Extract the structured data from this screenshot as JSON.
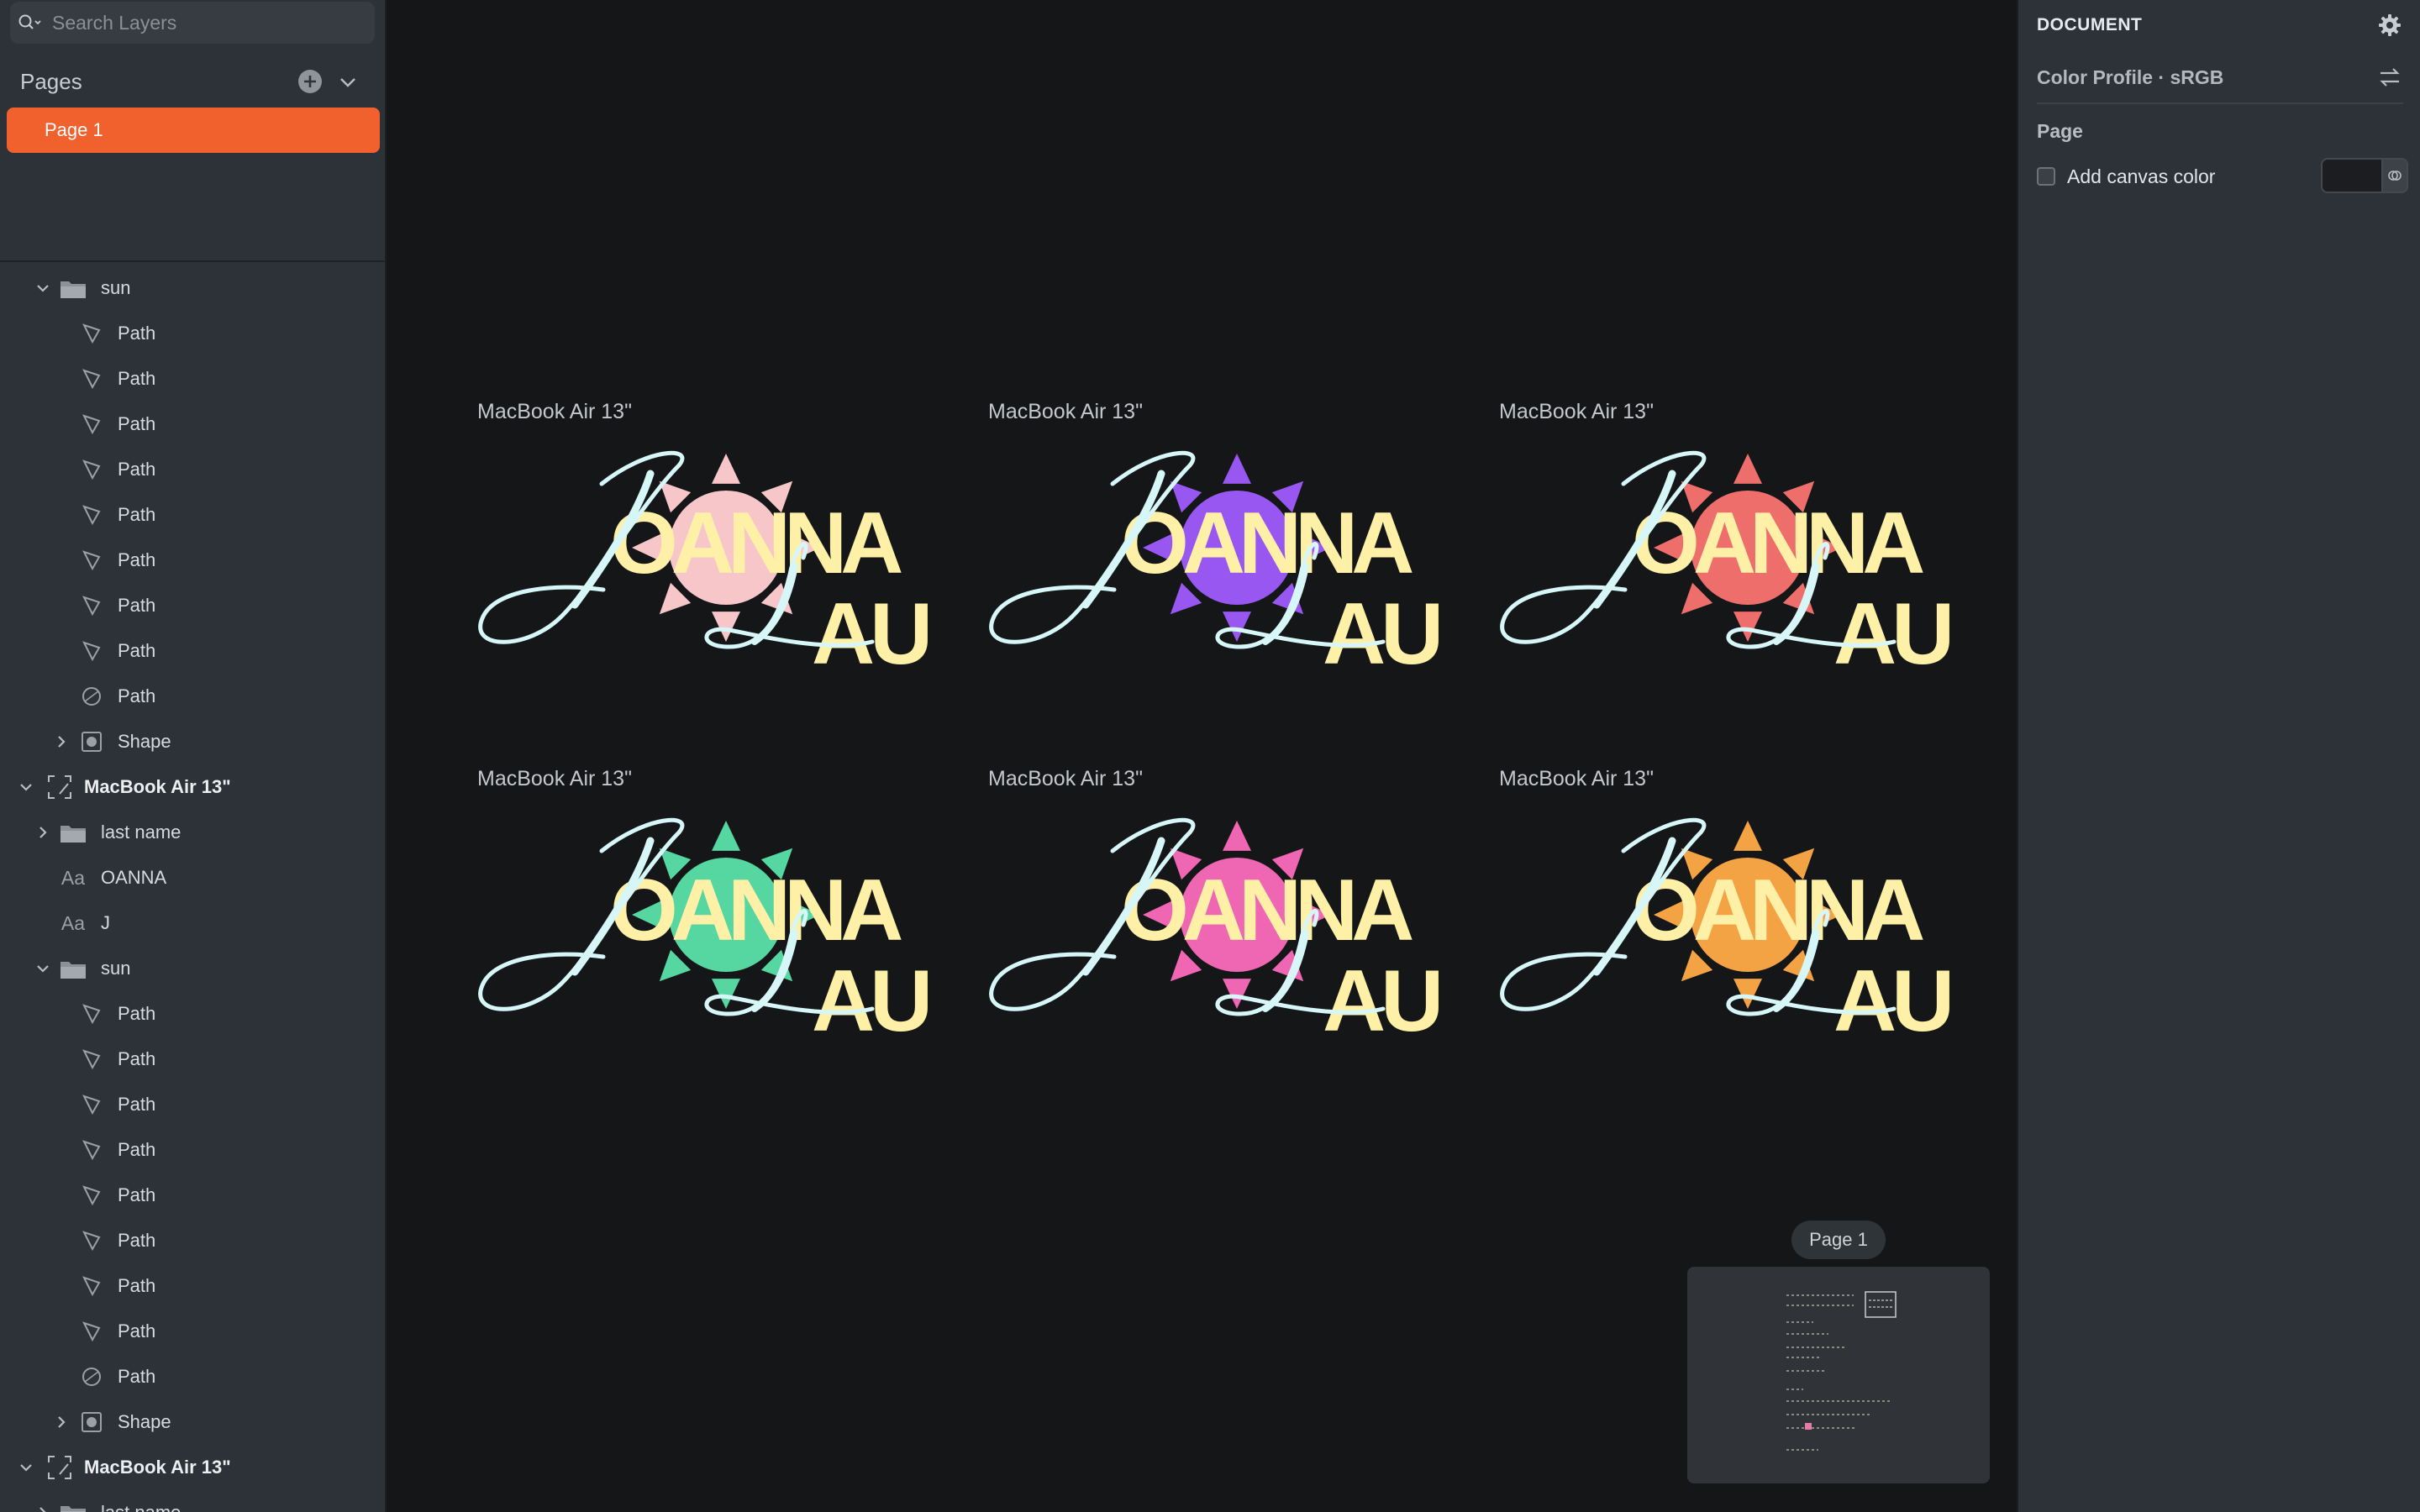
{
  "search": {
    "placeholder": "Search Layers"
  },
  "pages": {
    "title": "Pages",
    "items": [
      {
        "label": "Page 1",
        "selected": true
      }
    ]
  },
  "layers": [
    {
      "type": "group",
      "label": "sun",
      "depth": 2,
      "expanded": true
    },
    {
      "type": "path",
      "label": "Path",
      "depth": 3
    },
    {
      "type": "path",
      "label": "Path",
      "depth": 3
    },
    {
      "type": "path",
      "label": "Path",
      "depth": 3
    },
    {
      "type": "path",
      "label": "Path",
      "depth": 3
    },
    {
      "type": "path",
      "label": "Path",
      "depth": 3
    },
    {
      "type": "path",
      "label": "Path",
      "depth": 3
    },
    {
      "type": "path",
      "label": "Path",
      "depth": 3
    },
    {
      "type": "path",
      "label": "Path",
      "depth": 3
    },
    {
      "type": "oval",
      "label": "Path",
      "depth": 3
    },
    {
      "type": "shape",
      "label": "Shape",
      "depth": 3,
      "expanded": false
    },
    {
      "type": "artboard",
      "label": "MacBook Air 13\"",
      "depth": 1,
      "expanded": true
    },
    {
      "type": "group",
      "label": "last name",
      "depth": 2,
      "expanded": false
    },
    {
      "type": "text",
      "label": "OANNA",
      "depth": 2
    },
    {
      "type": "text",
      "label": "J",
      "depth": 2
    },
    {
      "type": "group",
      "label": "sun",
      "depth": 2,
      "expanded": true
    },
    {
      "type": "path",
      "label": "Path",
      "depth": 3
    },
    {
      "type": "path",
      "label": "Path",
      "depth": 3
    },
    {
      "type": "path",
      "label": "Path",
      "depth": 3
    },
    {
      "type": "path",
      "label": "Path",
      "depth": 3
    },
    {
      "type": "path",
      "label": "Path",
      "depth": 3
    },
    {
      "type": "path",
      "label": "Path",
      "depth": 3
    },
    {
      "type": "path",
      "label": "Path",
      "depth": 3
    },
    {
      "type": "path",
      "label": "Path",
      "depth": 3
    },
    {
      "type": "oval",
      "label": "Path",
      "depth": 3
    },
    {
      "type": "shape",
      "label": "Shape",
      "depth": 3,
      "expanded": false
    },
    {
      "type": "artboard",
      "label": "MacBook Air 13\"",
      "depth": 1,
      "expanded": true
    },
    {
      "type": "group",
      "label": "last name",
      "depth": 2,
      "expanded": false
    }
  ],
  "artboards": [
    {
      "title": "MacBook Air 13\"",
      "sun_color": "#f7c6c9"
    },
    {
      "title": "MacBook Air 13\"",
      "sun_color": "#9857f0"
    },
    {
      "title": "MacBook Air 13\"",
      "sun_color": "#ee6e6c"
    },
    {
      "title": "MacBook Air 13\"",
      "sun_color": "#56d6a0"
    },
    {
      "title": "MacBook Air 13\"",
      "sun_color": "#ef66b2"
    },
    {
      "title": "MacBook Air 13\"",
      "sun_color": "#f3a344"
    }
  ],
  "logo": {
    "script_letter": "J",
    "first_name": "OANNA",
    "script_letter_2": "L",
    "last_name": "AU",
    "script_color": "#d6f6f8",
    "block_color": "#fff0a8"
  },
  "page_pill": "Page 1",
  "inspector": {
    "title": "DOCUMENT",
    "color_profile": "Color Profile · sRGB",
    "page_section": "Page",
    "canvas_color_label": "Add canvas color",
    "canvas_color_checked": false
  },
  "colors": {
    "accent": "#f0612d",
    "sidebar_bg": "#2c3237",
    "canvas_bg": "#151618"
  }
}
